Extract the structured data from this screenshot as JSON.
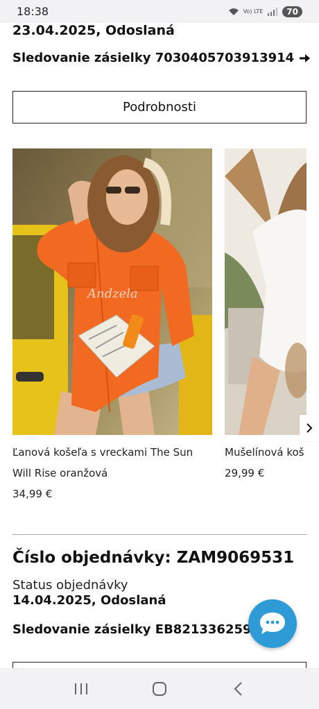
{
  "status_bar": {
    "time": "18:38",
    "network": "Vo) LTE",
    "battery": "70"
  },
  "previous_order": {
    "date_status": "23.04.2025, Odoslaná",
    "tracking_label": "Sledovanie zásielky 7030405703913914",
    "details_button": "Podrobnosti"
  },
  "products": [
    {
      "title": "Ľanová košeľa s vreckami The Sun Will Rise oranžová",
      "price": "34,99 €",
      "watermark": "Andzela"
    },
    {
      "title": "Mušelínová koš",
      "price": "29,99 €"
    }
  ],
  "order": {
    "number_label": "Číslo objednávky: ZAM9069531",
    "status_label": "Status objednávky",
    "date_status": "14.04.2025, Odoslaná",
    "tracking_label": "Sledovanie zásielky EB821336259SK"
  },
  "colors": {
    "accent": "#2f9bd6",
    "shirt": "#f26a21",
    "car": "#e7c21a"
  },
  "icons": {
    "chat": "chat-bubble-icon",
    "next": "chevron-right-icon",
    "arrow": "arrow-right-icon"
  }
}
